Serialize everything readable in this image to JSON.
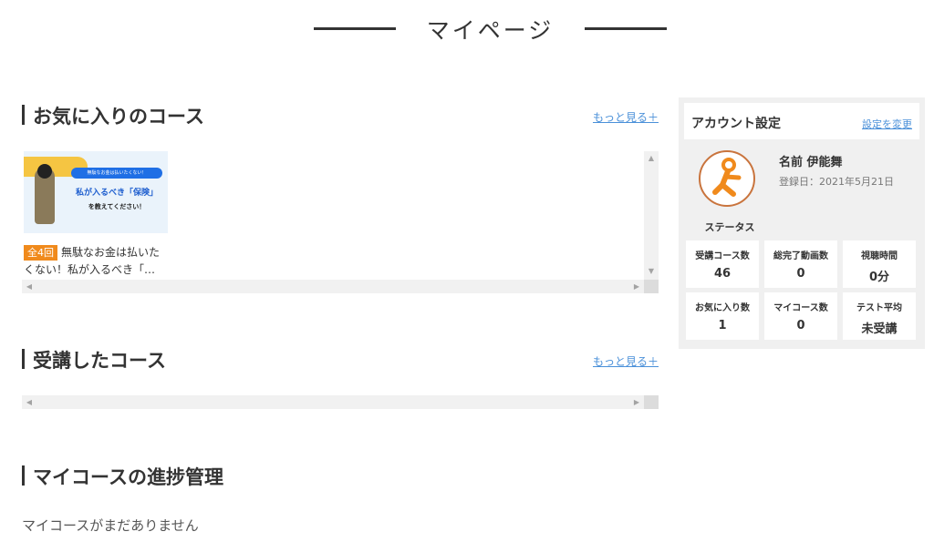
{
  "page": {
    "title": "マイページ"
  },
  "favorites": {
    "title": "お気に入りのコース",
    "more_label": "もっと見る＋",
    "courses": [
      {
        "badge": "全4回",
        "title": "無駄なお金は払いたくない！私が入るべき「…",
        "thumb_pill": "無駄なお金は払いたくない！",
        "thumb_main": "私が入るべき「保険」",
        "thumb_sub": "を教えてください！"
      }
    ]
  },
  "taken": {
    "title": "受講したコース",
    "more_label": "もっと見る＋"
  },
  "progress": {
    "title": "マイコースの進捗管理",
    "empty_message": "マイコースがまだありません"
  },
  "account": {
    "title": "アカウント設定",
    "change_label": "設定を変更",
    "name_line": "名前 伊能舞",
    "registered_line": "登録日：2021年5月21日",
    "status_label": "ステータス",
    "avatar_color": "#f08a1c",
    "stats": [
      {
        "label": "受講コース数",
        "value": "46"
      },
      {
        "label": "総完了動画数",
        "value": "0"
      },
      {
        "label": "視聴時間",
        "value": "0分"
      },
      {
        "label": "お気に入り数",
        "value": "1"
      },
      {
        "label": "マイコース数",
        "value": "0"
      },
      {
        "label": "テスト平均",
        "value": "未受講"
      }
    ]
  }
}
